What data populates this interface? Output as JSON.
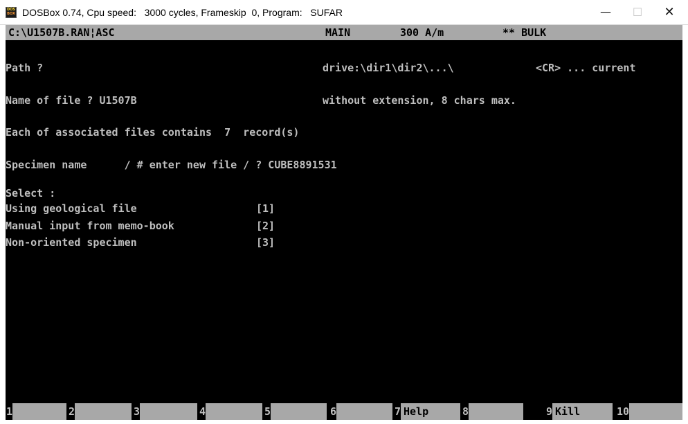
{
  "window": {
    "title": "DOSBox 0.74, Cpu speed:   3000 cycles, Frameskip  0, Program:   SUFAR",
    "icon_top": "DOS",
    "icon_bottom": "BOX",
    "minimize_icon": "—",
    "maximize_icon": "☐",
    "close_icon": "✕"
  },
  "status": {
    "path": "C:\\U1507B.RAN¦ASC",
    "mode": "MAIN",
    "field": "300 A/m",
    "type": "** BULK"
  },
  "prompts": {
    "path_label": "Path ?",
    "path_hint": "drive:\\dir1\\dir2\\...\\",
    "path_current": "<CR> ... current",
    "filename_label": "Name of file ? U1507B",
    "filename_hint": "without extension, 8 chars max.",
    "records_text": "Each of associated files contains  7  record(s)",
    "specimen_text": "Specimen name      / # enter new file / ? CUBE8891531",
    "select_label": "Select :",
    "options": [
      {
        "label": "Using geological file",
        "key": "[1]"
      },
      {
        "label": "Manual input from memo-book",
        "key": "[2]"
      },
      {
        "label": "Non-oriented specimen",
        "key": "[3]"
      }
    ]
  },
  "function_keys": [
    {
      "num": "1",
      "label": ""
    },
    {
      "num": "2",
      "label": ""
    },
    {
      "num": "3",
      "label": ""
    },
    {
      "num": "4",
      "label": ""
    },
    {
      "num": "5",
      "label": ""
    },
    {
      "num": "6",
      "label": ""
    },
    {
      "num": "7",
      "label": "Help"
    },
    {
      "num": "8",
      "label": ""
    },
    {
      "num": "9",
      "label": "Kill"
    },
    {
      "num": "10",
      "label": ""
    }
  ],
  "colors": {
    "screen_bg": "#000000",
    "text": "#bfbfbf",
    "bar_bg": "#a8a8a8"
  }
}
